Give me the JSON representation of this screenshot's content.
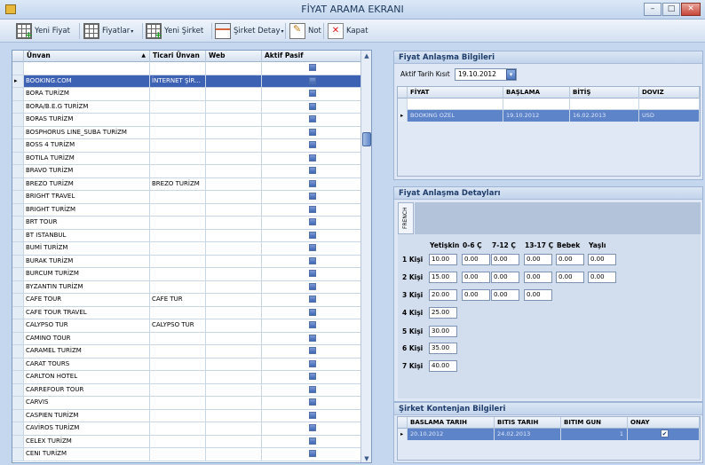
{
  "window": {
    "title": "FİYAT ARAMA EKRANI"
  },
  "toolbar": {
    "new_price": "Yeni Fiyat",
    "prices": "Fiyatlar",
    "new_company": "Yeni Şirket",
    "company_detail": "Şirket Detay",
    "note": "Not",
    "close": "Kapat"
  },
  "companies": {
    "headers": [
      "Ünvan",
      "Ticari Ünvan",
      "Web",
      "Aktif Pasif"
    ],
    "rows": [
      {
        "name": "BOOKING.COM",
        "trade": "İNTERNET ŞİR...",
        "web": ""
      },
      {
        "name": "BORA TURİZM",
        "trade": "",
        "web": ""
      },
      {
        "name": "BORA/B.E.G TURİZM",
        "trade": "",
        "web": ""
      },
      {
        "name": "BORAS TURİZM",
        "trade": "",
        "web": ""
      },
      {
        "name": "BOSPHORUS LINE_SUBA TURİZM",
        "trade": "",
        "web": ""
      },
      {
        "name": "BOSS 4 TURİZM",
        "trade": "",
        "web": ""
      },
      {
        "name": "BOTILA TURİZM",
        "trade": "",
        "web": ""
      },
      {
        "name": "BRAVO TURİZM",
        "trade": "",
        "web": ""
      },
      {
        "name": "BREZO TURİZM",
        "trade": "BREZO TURİZM",
        "web": ""
      },
      {
        "name": "BRIGHT TRAVEL",
        "trade": "",
        "web": ""
      },
      {
        "name": "BRIGHT TURİZM",
        "trade": "",
        "web": ""
      },
      {
        "name": "BRT TOUR",
        "trade": "",
        "web": ""
      },
      {
        "name": "BT ISTANBUL",
        "trade": "",
        "web": ""
      },
      {
        "name": "BUMİ TURİZM",
        "trade": "",
        "web": ""
      },
      {
        "name": "BURAK TURİZM",
        "trade": "",
        "web": ""
      },
      {
        "name": "BURCUM TURİZM",
        "trade": "",
        "web": ""
      },
      {
        "name": "BYZANTIN TURİZM",
        "trade": "",
        "web": ""
      },
      {
        "name": "CAFE TOUR",
        "trade": "CAFE TUR",
        "web": ""
      },
      {
        "name": "CAFE TOUR TRAVEL",
        "trade": "",
        "web": ""
      },
      {
        "name": "CALYPSO TUR",
        "trade": "CALYPSO TUR",
        "web": ""
      },
      {
        "name": "CAMINO TOUR",
        "trade": "",
        "web": ""
      },
      {
        "name": "CARAMEL TURİZM",
        "trade": "",
        "web": ""
      },
      {
        "name": "CARAT TOURS",
        "trade": "",
        "web": ""
      },
      {
        "name": "CARLTON HOTEL",
        "trade": "",
        "web": ""
      },
      {
        "name": "CARREFOUR TOUR",
        "trade": "",
        "web": ""
      },
      {
        "name": "CARVIS",
        "trade": "",
        "web": ""
      },
      {
        "name": "CASPIEN TURİZM",
        "trade": "",
        "web": ""
      },
      {
        "name": "CAVİROS TURİZM",
        "trade": "",
        "web": ""
      },
      {
        "name": "CELEX TURİZM",
        "trade": "",
        "web": ""
      },
      {
        "name": "CENI TURİZM",
        "trade": "",
        "web": ""
      }
    ]
  },
  "agreement": {
    "title": "Fiyat Anlaşma Bilgileri",
    "date_label": "Aktif Tarih Kısıt",
    "date_value": "19.10.2012",
    "headers": [
      "FİYAT",
      "BAŞLAMA",
      "BİTİŞ",
      "DOVIZ"
    ],
    "row": [
      "BOOKING OZEL",
      "19.10.2012",
      "16.02.2013",
      "USD"
    ]
  },
  "details": {
    "title": "Fiyat Anlaşma Detayları",
    "tab": "FRENCH",
    "col_headers": [
      "Yetişkin",
      "0-6 Ç",
      "7-12 Ç",
      "13-17 Ç",
      "Bebek",
      "Yaşlı"
    ],
    "rows": [
      {
        "label": "1 Kişi",
        "values": [
          "10.00",
          "0.00",
          "0.00",
          "0.00",
          "0.00",
          "0.00"
        ]
      },
      {
        "label": "2 Kişi",
        "values": [
          "15.00",
          "0.00",
          "0.00",
          "0.00",
          "0.00",
          "0.00"
        ]
      },
      {
        "label": "3 Kişi",
        "values": [
          "20.00",
          "0.00",
          "0.00",
          "0.00"
        ]
      },
      {
        "label": "4 Kişi",
        "values": [
          "25.00"
        ]
      },
      {
        "label": "5 Kişi",
        "values": [
          "30.00"
        ]
      },
      {
        "label": "6 Kişi",
        "values": [
          "35.00"
        ]
      },
      {
        "label": "7 Kişi",
        "values": [
          "40.00"
        ]
      }
    ]
  },
  "quota": {
    "title": "Şirket Kontenjan Bilgileri",
    "headers": [
      "BASLAMA TARIH",
      "BITIS TARIH",
      "BITIM GUN",
      "ONAY"
    ],
    "row": [
      "20.10.2012",
      "24.02.2013",
      "1",
      "✔"
    ]
  }
}
